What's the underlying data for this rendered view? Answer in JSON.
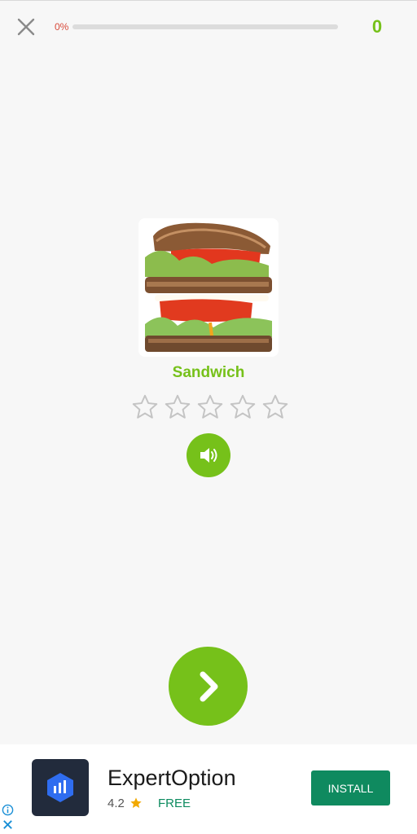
{
  "header": {
    "close_icon": "close-icon",
    "progress_label": "0%",
    "progress_value": 0,
    "score": "0"
  },
  "card": {
    "image_icon": "sandwich-photo",
    "word": "Sandwich",
    "stars_total": 5,
    "stars_filled": 0,
    "sound_icon": "speaker-icon"
  },
  "next_icon": "chevron-right-icon",
  "ad": {
    "app_name": "ExpertOption",
    "rating": "4.2",
    "price": "FREE",
    "install_label": "INSTALL"
  },
  "colors": {
    "accent": "#76c11a",
    "progress_text": "#d84a3a",
    "install": "#0f8a5f",
    "background": "#f7f7f7"
  }
}
